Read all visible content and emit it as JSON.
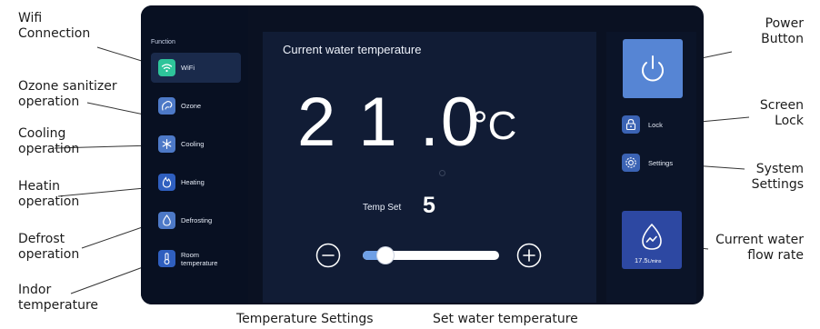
{
  "annotations": {
    "wifi": [
      "Wifi",
      "Connection"
    ],
    "ozone": [
      "Ozone sanitizer",
      "operation"
    ],
    "cooling": [
      "Cooling",
      "operation"
    ],
    "heating": [
      "Heatin",
      "operation"
    ],
    "defrost": [
      "Defrost",
      "operation"
    ],
    "indoor": [
      "Indor",
      "temperature"
    ],
    "power": [
      "Power",
      "Button"
    ],
    "lock": [
      "Screen",
      "Lock"
    ],
    "settings": [
      "System",
      "Settings"
    ],
    "flow": [
      "Current water",
      "flow rate"
    ],
    "temp_settings": "Temperature Settings",
    "set_temp": "Set water temperature"
  },
  "sidebar": {
    "title": "Function",
    "items": [
      {
        "label": "WiFi",
        "icon": "wifi-icon",
        "active": true
      },
      {
        "label": "Ozone",
        "icon": "ozone-icon"
      },
      {
        "label": "Cooling",
        "icon": "snowflake-icon"
      },
      {
        "label": "Heating",
        "icon": "flame-icon"
      },
      {
        "label": "Defrosting",
        "icon": "droplet-icon"
      },
      {
        "label_lines": [
          "Room",
          "temperature"
        ],
        "icon": "thermometer-icon"
      }
    ]
  },
  "main": {
    "title": "Current water temperature",
    "temperature": "2 1 .0",
    "unit": "°C",
    "temp_set_label": "Temp Set",
    "temp_set_value": "5",
    "slider_level": 0.12
  },
  "right": {
    "lock_label": "Lock",
    "settings_label": "Settings",
    "flow_value": "17.5",
    "flow_unit": "L/mins"
  },
  "colors": {
    "device_bg": "#0a1122",
    "panel_bg": "#111c35",
    "power_button": "#5685d4",
    "flow_box": "#2d48a2",
    "wifi_icon": "#2ec49a",
    "accent_icon": "#4d79c7",
    "heating_icon": "#2f5fbf"
  }
}
